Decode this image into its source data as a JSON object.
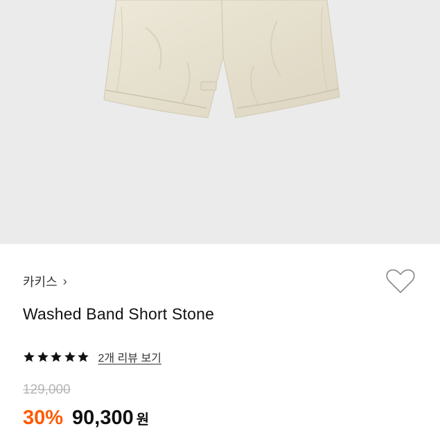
{
  "product": {
    "image_alt": "Washed Band Short Stone",
    "brand": "카키스",
    "title": "Washed Band Short Stone",
    "rating": 5,
    "rating_max": 5,
    "review_link": "2개 리뷰 보기",
    "original_price": "129,000",
    "discount": "30%",
    "sale_price": "90,300",
    "currency": "원"
  },
  "icons": {
    "brand_chevron": "chevron-right-icon",
    "wishlist": "heart-outline-icon",
    "star": "star-filled-icon"
  },
  "colors": {
    "discount": "#ff5a00",
    "image_background": "#ebebeb",
    "muted_price": "#b4b4b4"
  }
}
